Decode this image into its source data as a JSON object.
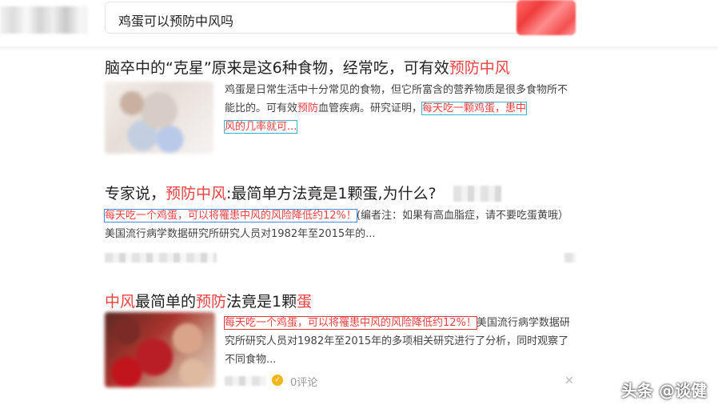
{
  "search": {
    "query": "鸡蛋可以预防中风吗"
  },
  "results": [
    {
      "title_parts": [
        "脑卒中的“克星”原来是这6种食物，经常吃，可有效",
        "预防中风"
      ],
      "snippet_a": "鸡蛋是日常生活中十分常见的食物，但它所富含的营养物质是很多食物所不能比的。可有效",
      "snippet_hl": "预防",
      "snippet_b": "血管疾病。研究证明，",
      "snippet_red_1": "每天吃一颗鸡蛋，患中",
      "snippet_red_2": "风的几率就可..."
    },
    {
      "title_a": "专家说，",
      "title_hl": "预防中风",
      "title_b": ":最简单方法竟是1颗蛋,为什么?",
      "snippet_red": "每天吃一个鸡蛋，可以将罹患中风的风险降低约12%！",
      "snippet_rest": "(编者注：如果有高血脂症，请不要吃蛋黄哦）美国流行病学数据研究所研究人员对1982年至2015年的..."
    },
    {
      "title_hl_1": "中风",
      "title_a": "最简单的",
      "title_hl_2": "预防",
      "title_b": "法竟是1颗",
      "title_hl_3": "蛋",
      "snippet_red": "每天吃一个鸡蛋，可以将罹患中风的风险降低约12%！",
      "snippet_rest": "美国流行病学数据研究所研究人员对1982年至2015年的多项相关研究进行了分析，同时观察了不同食物...",
      "comments": "0评论"
    }
  ],
  "watermark": "头条 @谈健",
  "colors": {
    "highlight": "#f04142",
    "teal_box": "#35b8c8",
    "blue_box": "#4b8be0",
    "red_box": "#e23a3a"
  }
}
